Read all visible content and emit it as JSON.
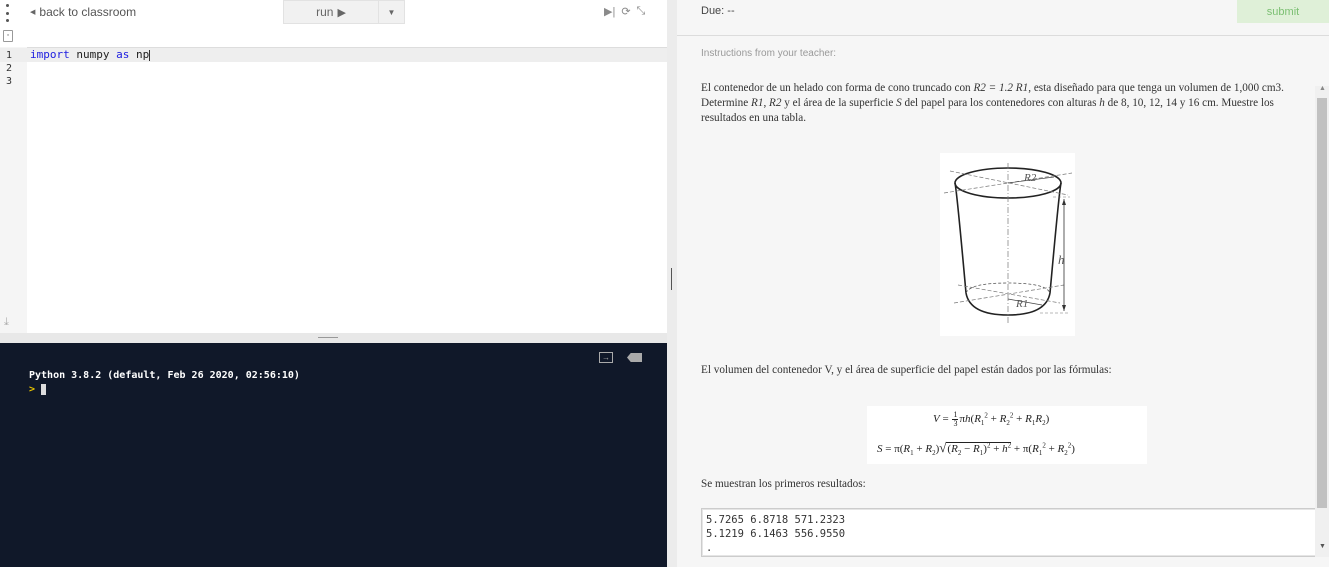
{
  "toolbar": {
    "back_label": "back to classroom",
    "run_label": "run"
  },
  "editor": {
    "line_numbers": [
      "1",
      "2",
      "3"
    ],
    "code": {
      "kw1": "import",
      "mod": " numpy ",
      "kw2": "as",
      "alias": " np"
    }
  },
  "console": {
    "banner": "Python 3.8.2 (default, Feb 26 2020, 02:56:10)",
    "prompt": ">"
  },
  "assignment": {
    "due": "Due: --",
    "submit_label": "submit",
    "instructions_label": "Instructions from your teacher:",
    "problem": {
      "p1": "El contenedor de un helado con forma de cono truncado con ",
      "eq": "R2 = 1.2 R1",
      "p2": ", esta diseñado para que tenga un volumen de 1,000 cm3. Determine ",
      "r1": "R1",
      "comma": ", ",
      "r2": "R2",
      "p3": " y el área de la superficie ",
      "s": "S",
      "p4": " del papel para los contenedores con alturas ",
      "h": "h",
      "p5": " de 8, 10, 12, 14 y 16 cm. Muestre los resultados en una tabla."
    },
    "figure_labels": {
      "top": "R2",
      "height": "h",
      "bottom": "R1"
    },
    "formulas_text": "El volumen del contenedor V, y el área de superficie del papel están dados por las fórmulas:",
    "first_results_text": "Se muestran los primeros resultados:",
    "results": [
      "5.7265 6.8718 571.2323",
      "5.1219 6.1463 556.9550",
      "."
    ]
  },
  "colors": {
    "console_bg": "#101829",
    "submit_bg": "#dff0d8",
    "submit_text": "#7bbf72",
    "keyword": "#1c1ce0"
  }
}
